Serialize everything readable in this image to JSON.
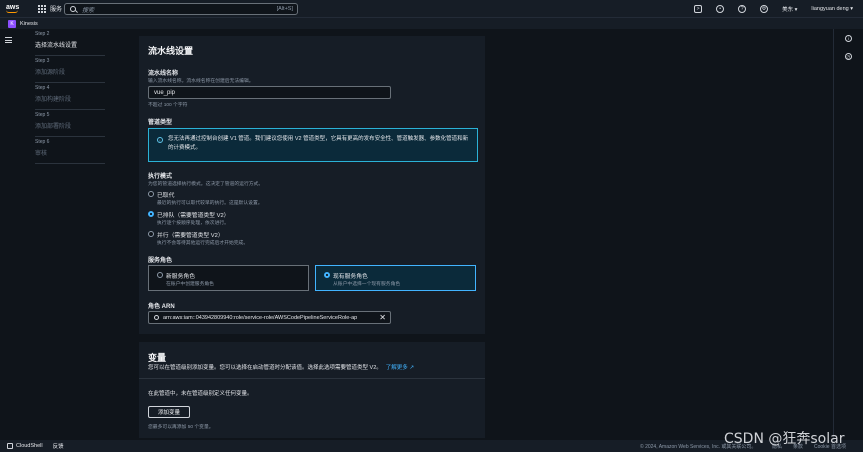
{
  "topbar": {
    "logo": "aws",
    "services_label": "服务",
    "search_placeholder": "搜索",
    "search_shortcut": "[Alt+S]",
    "region": "美东",
    "user": "liangyuan deng"
  },
  "service_bar": {
    "badge": "K",
    "name": "Kinesis"
  },
  "steps": [
    {
      "num": "Step 2",
      "name": "选择流水线设置",
      "active": true
    },
    {
      "num": "Step 3",
      "name": "添加源阶段"
    },
    {
      "num": "Step 4",
      "name": "添加构建阶段"
    },
    {
      "num": "Step 5",
      "name": "添加部署阶段"
    },
    {
      "num": "Step 6",
      "name": "审核"
    }
  ],
  "settings": {
    "title": "流水线设置",
    "name_label": "流水线名称",
    "name_desc": "输入流水线名称。流水线名称在创建后无法编辑。",
    "name_value": "vue_pip",
    "name_hint": "不超过 100 个字符",
    "type_label": "管道类型",
    "type_info": "您无法再通过控制台创建 V1 管道。我们建议您使用 V2 管道类型，它具有更高的发布安全性、管道触发器、参数化管道和新的计费模式。",
    "mode_label": "执行模式",
    "mode_desc": "为您的管道选择执行模式。这决定了管道的运行方式。",
    "modes": [
      {
        "label": "已取代",
        "desc": "最近的执行可以取代较早的执行。这是默认设置。"
      },
      {
        "label": "已排队（需要管道类型 V2）",
        "desc": "执行逐个按顺序处理，依次进行。"
      },
      {
        "label": "并行（需要管道类型 V2）",
        "desc": "执行不会等待其他运行完成后才开始完成。"
      }
    ],
    "role_label": "服务角色",
    "roles": [
      {
        "label": "新服务角色",
        "desc": "在账户中创建服务角色"
      },
      {
        "label": "现有服务角色",
        "desc": "从账户中选择一个现有服务角色"
      }
    ],
    "arn_label": "角色 ARN",
    "arn_value": "arn:aws:iam::043942809940:role/service-role/AWSCodePipelineServiceRole-ap"
  },
  "variables": {
    "title": "变量",
    "desc": "您可以在管道级别添加变量。您可以选择在启动管道时分配该值。选择此选项需要管道类型 V2。",
    "learn_more": "了解更多",
    "empty": "在此管道中，未在管道级别定义任何变量。",
    "add_button": "添加变量",
    "footnote": "您最多可以再添加 50 个变量。"
  },
  "footer": {
    "cloudshell": "CloudShell",
    "feedback": "反馈",
    "copyright": "© 2024, Amazon Web Services, Inc. 或其关联公司。",
    "privacy": "隐私",
    "terms": "条款",
    "cookie": "Cookie 首选项"
  },
  "watermark": "CSDN @狂奔solar"
}
